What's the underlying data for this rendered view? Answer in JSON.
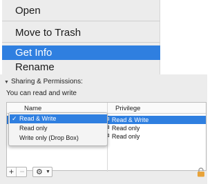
{
  "context_menu": {
    "items": [
      {
        "label": "Open"
      },
      {
        "label": "Move to Trash"
      },
      {
        "label": "Get Info",
        "highlighted": true
      },
      {
        "label": "Rename"
      }
    ]
  },
  "info_panel": {
    "section_title": "Sharing & Permissions:",
    "permission_note": "You can read and write",
    "table": {
      "columns": [
        "Name",
        "Privilege"
      ],
      "rows": [
        {
          "privilege": "Read & Write",
          "selected": true
        },
        {
          "privilege": "Read only"
        },
        {
          "privilege": "Read only"
        }
      ]
    },
    "privilege_menu": {
      "options": [
        {
          "label": "Read & Write",
          "checked": true
        },
        {
          "label": "Read only"
        },
        {
          "label": "Write only (Drop Box)"
        }
      ]
    },
    "toolbar": {
      "add_label": "+",
      "remove_label": "−"
    }
  },
  "colors": {
    "selection": "#2f7fe0",
    "lock": "#e8a33a",
    "panel_bg": "#ececec"
  },
  "icons": [
    "check-icon",
    "stepper-arrows-icon",
    "gear-icon",
    "caret-down-icon",
    "lock-icon",
    "disclosure-triangle-icon"
  ]
}
